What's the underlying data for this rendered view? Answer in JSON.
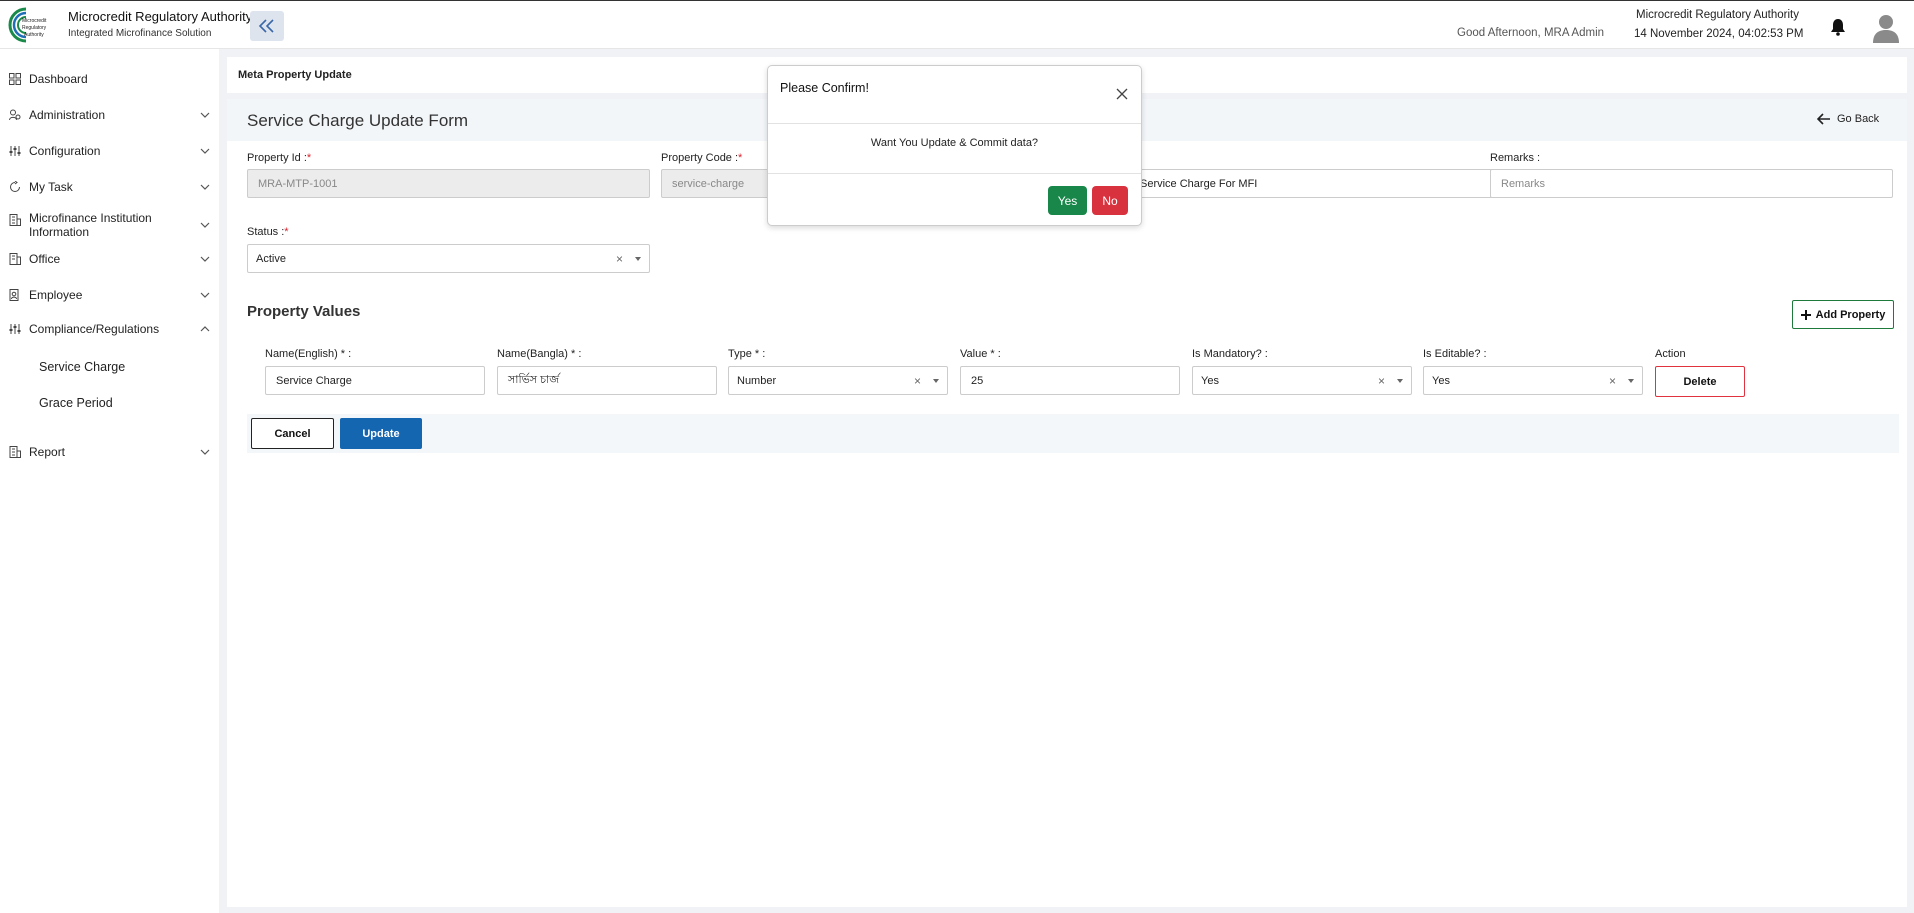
{
  "header": {
    "brand_title": "Microcredit Regulatory Authority",
    "brand_subtitle": "Integrated Microfinance Solution",
    "logo_text_1": "Microcredit",
    "logo_text_2": "Regulatory",
    "logo_text_3": "Authority",
    "greeting": "Good Afternoon, MRA Admin",
    "org_name": "Microcredit Regulatory Authority",
    "datetime": "14 November 2024, 04:02:53 PM"
  },
  "sidebar": {
    "items": [
      {
        "label": "Dashboard"
      },
      {
        "label": "Administration"
      },
      {
        "label": "Configuration"
      },
      {
        "label": "My Task"
      },
      {
        "label": "Microfinance Institution Information"
      },
      {
        "label": "Office"
      },
      {
        "label": "Employee"
      },
      {
        "label": "Compliance/Regulations"
      },
      {
        "label": "Report"
      }
    ],
    "sub_items": [
      {
        "label": "Service Charge"
      },
      {
        "label": "Grace Period"
      }
    ]
  },
  "page": {
    "breadcrumb": "Meta Property Update",
    "form_title": "Service Charge Update Form",
    "go_back": "Go Back"
  },
  "form": {
    "property_id": {
      "label": "Property Id :",
      "value": "MRA-MTP-1001"
    },
    "property_code": {
      "label": "Property Code :",
      "value": "service-charge"
    },
    "property_name": {
      "value": "Service Charge For MFI"
    },
    "remarks": {
      "label": "Remarks :",
      "placeholder": "Remarks"
    },
    "status": {
      "label": "Status :",
      "value": "Active"
    },
    "required_mark": "*"
  },
  "property_values": {
    "title": "Property Values",
    "add_label": "Add Property",
    "columns": [
      "Name(English) * :",
      "Name(Bangla) * :",
      "Type * :",
      "Value * :",
      "Is Mandatory? :",
      "Is Editable? :",
      "Action"
    ],
    "row": {
      "name_en": "Service Charge",
      "name_bn": "সার্ভিস চার্জ",
      "type": "Number",
      "value": "25",
      "is_mandatory": "Yes",
      "is_editable": "Yes",
      "delete_label": "Delete"
    }
  },
  "actions": {
    "cancel": "Cancel",
    "update": "Update"
  },
  "modal": {
    "title": "Please Confirm!",
    "message": "Want You Update & Commit data?",
    "yes": "Yes",
    "no": "No"
  },
  "colors": {
    "primary": "#1566b0",
    "success": "#19874a",
    "danger": "#d9323f",
    "logo_green": "#1a8a4a"
  },
  "icons": {
    "bell": "bell-icon",
    "avatar": "user-avatar-icon",
    "collapse": "double-chevron-left-icon",
    "close": "close-icon",
    "back": "arrow-left-icon",
    "plus": "plus-icon"
  }
}
